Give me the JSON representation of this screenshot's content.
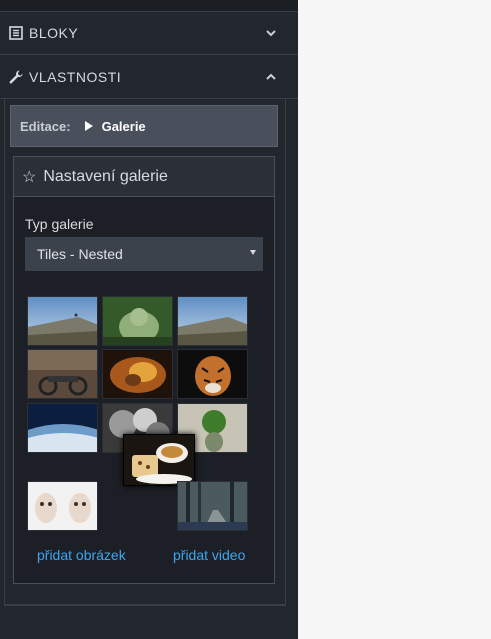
{
  "sections": {
    "bloky": {
      "label": "BLOKY",
      "icon": "list-icon"
    },
    "vlastnosti": {
      "label": "VLASTNOSTI",
      "icon": "wrench-icon"
    }
  },
  "edit": {
    "label": "Editace:",
    "value": "Galerie"
  },
  "gallery": {
    "title": "Nastavení galerie",
    "type_label": "Typ galerie",
    "type_value": "Tiles - Nested",
    "thumbnails": [
      "landscape-hill",
      "ogre-creature",
      "landscape-hill",
      "motorcycle-garage",
      "fire-dragon",
      "tiger",
      "earth-horizon",
      "smoke-clouds",
      "green-tree-head",
      "coffee-cake",
      "two-faces",
      "forest-road"
    ],
    "add_image": "přidat obrázek",
    "add_video": "přidat video"
  },
  "colors": {
    "panel": "#22262d",
    "accent_link": "#3ea6f0",
    "edit_bar": "#49505b"
  }
}
